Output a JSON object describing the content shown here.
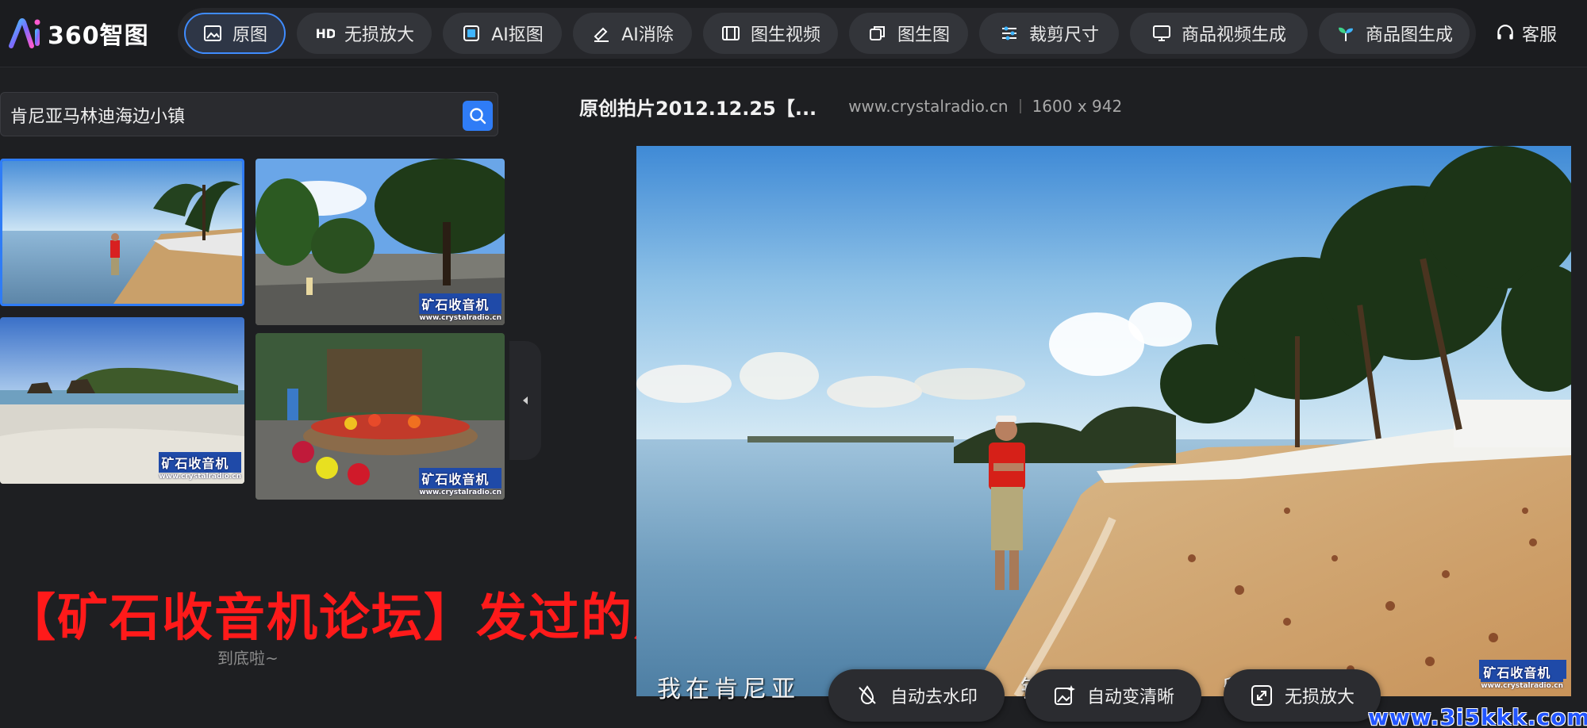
{
  "brand": {
    "name": "360智图"
  },
  "nav": [
    {
      "label": "原图",
      "icon": "image-icon",
      "active": true
    },
    {
      "label": "无损放大",
      "icon": "hd-icon",
      "active": false
    },
    {
      "label": "AI抠图",
      "icon": "cutout-icon",
      "active": false
    },
    {
      "label": "AI消除",
      "icon": "eraser-icon",
      "active": false
    },
    {
      "label": "图生视频",
      "icon": "film-icon",
      "active": false
    },
    {
      "label": "图生图",
      "icon": "layers-icon",
      "active": false
    },
    {
      "label": "裁剪尺寸",
      "icon": "sliders-icon",
      "active": false
    },
    {
      "label": "商品视频生成",
      "icon": "monitor-icon",
      "active": false
    },
    {
      "label": "商品图生成",
      "icon": "sprout-icon",
      "active": false
    }
  ],
  "support": {
    "label": "客服"
  },
  "search": {
    "query": "肯尼亚马林迪海边小镇"
  },
  "thumbnails": [
    {
      "name": "beach-man",
      "watermark_big": "",
      "watermark_small": ""
    },
    {
      "name": "street-trees",
      "watermark_big": "矿石收音机",
      "watermark_small": "www.crystalradio.cn"
    },
    {
      "name": "rock-island",
      "watermark_big": "矿石收音机",
      "watermark_small": "www.crystalradio.cn"
    },
    {
      "name": "flower-market",
      "watermark_big": "矿石收音机",
      "watermark_small": "www.crystalradio.cn"
    }
  ],
  "list_end": "到底啦~",
  "overlay_text": "【矿石收音机论坛】发过的照片",
  "image_info": {
    "title": "原创拍片2012.12.25【...",
    "source": "www.crystalradio.cn",
    "size": "1600 x 942"
  },
  "main_image": {
    "caption": "我在肯尼亚",
    "caption2": "镇",
    "caption3": "留影",
    "watermark_big": "矿石收音机",
    "watermark_small": "www.crystalradio.cn"
  },
  "actions": [
    {
      "label": "自动去水印",
      "icon": "no-watermark-icon"
    },
    {
      "label": "自动变清晰",
      "icon": "sparkle-image-icon"
    },
    {
      "label": "无损放大",
      "icon": "expand-icon"
    }
  ],
  "site_watermark": "www.3i5kkk.com",
  "colors": {
    "accent": "#2f7cf6",
    "overlay_red": "#ff1a1a",
    "bg": "#1e1f22"
  }
}
